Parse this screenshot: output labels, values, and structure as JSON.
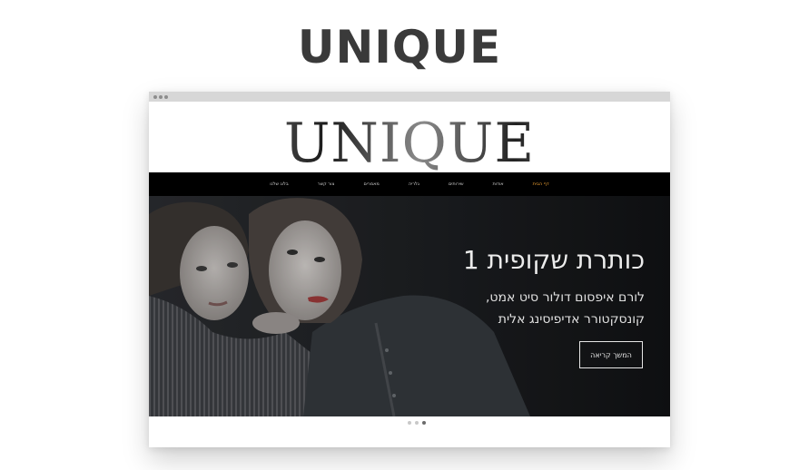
{
  "title": "UNIQUE",
  "site": {
    "logo": "UNIQUE",
    "nav": [
      "דף הבית",
      "אודות",
      "שירותים",
      "גלריה",
      "מאמרים",
      "צור קשר",
      "בלוג שלנו"
    ],
    "active_nav_index": 0,
    "accent": "#f0a233"
  },
  "hero": {
    "headline": "כותרת שקופית 1",
    "sub_line1": "לורם איפסום דולור סיט אמט,",
    "sub_line2": "קונסקטורר אדיפיסינג אלית",
    "button": "המשך קריאה"
  },
  "slider": {
    "count": 3,
    "active_index": 2
  }
}
